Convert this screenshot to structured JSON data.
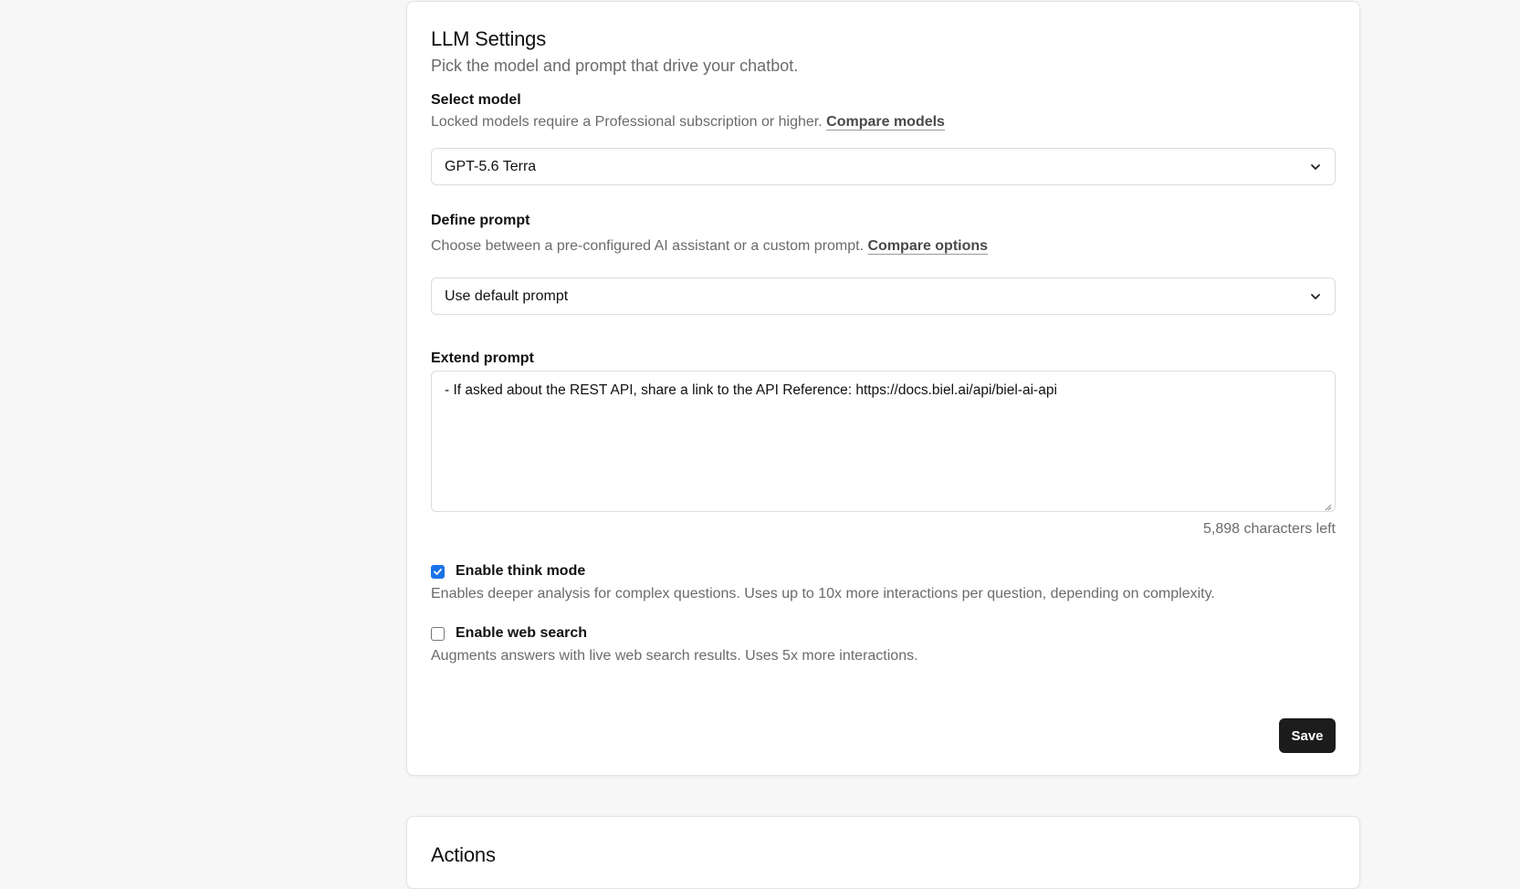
{
  "llm_settings": {
    "title": "LLM Settings",
    "subtitle": "Pick the model and prompt that drive your chatbot.",
    "select_model": {
      "label": "Select model",
      "help_text": "Locked models require a Professional subscription or higher.",
      "help_link": "Compare models",
      "selected_value": "GPT-5.6 Terra"
    },
    "define_prompt": {
      "label": "Define prompt",
      "help_text": "Choose between a pre-configured AI assistant or a custom prompt.",
      "help_link": "Compare options",
      "selected_value": "Use default prompt"
    },
    "extend_prompt": {
      "label": "Extend prompt",
      "value": "- If asked about the REST API, share a link to the API Reference: https://docs.biel.ai/api/biel-ai-api",
      "chars_left": "5,898 characters left"
    },
    "think_mode": {
      "label": "Enable think mode",
      "checked": true,
      "description": "Enables deeper analysis for complex questions. Uses up to 10x more interactions per question, depending on complexity."
    },
    "web_search": {
      "label": "Enable web search",
      "checked": false,
      "description": "Augments answers with live web search results. Uses 5x more interactions."
    },
    "save_label": "Save"
  },
  "actions": {
    "title": "Actions"
  },
  "colors": {
    "background": "#f7f7f7",
    "checkbox_accent": "#1a73e8",
    "save_button": "#1c1c1c"
  },
  "icons": {
    "select_chevron": "chevron-down-icon",
    "checkbox_check": "checkmark-icon"
  }
}
